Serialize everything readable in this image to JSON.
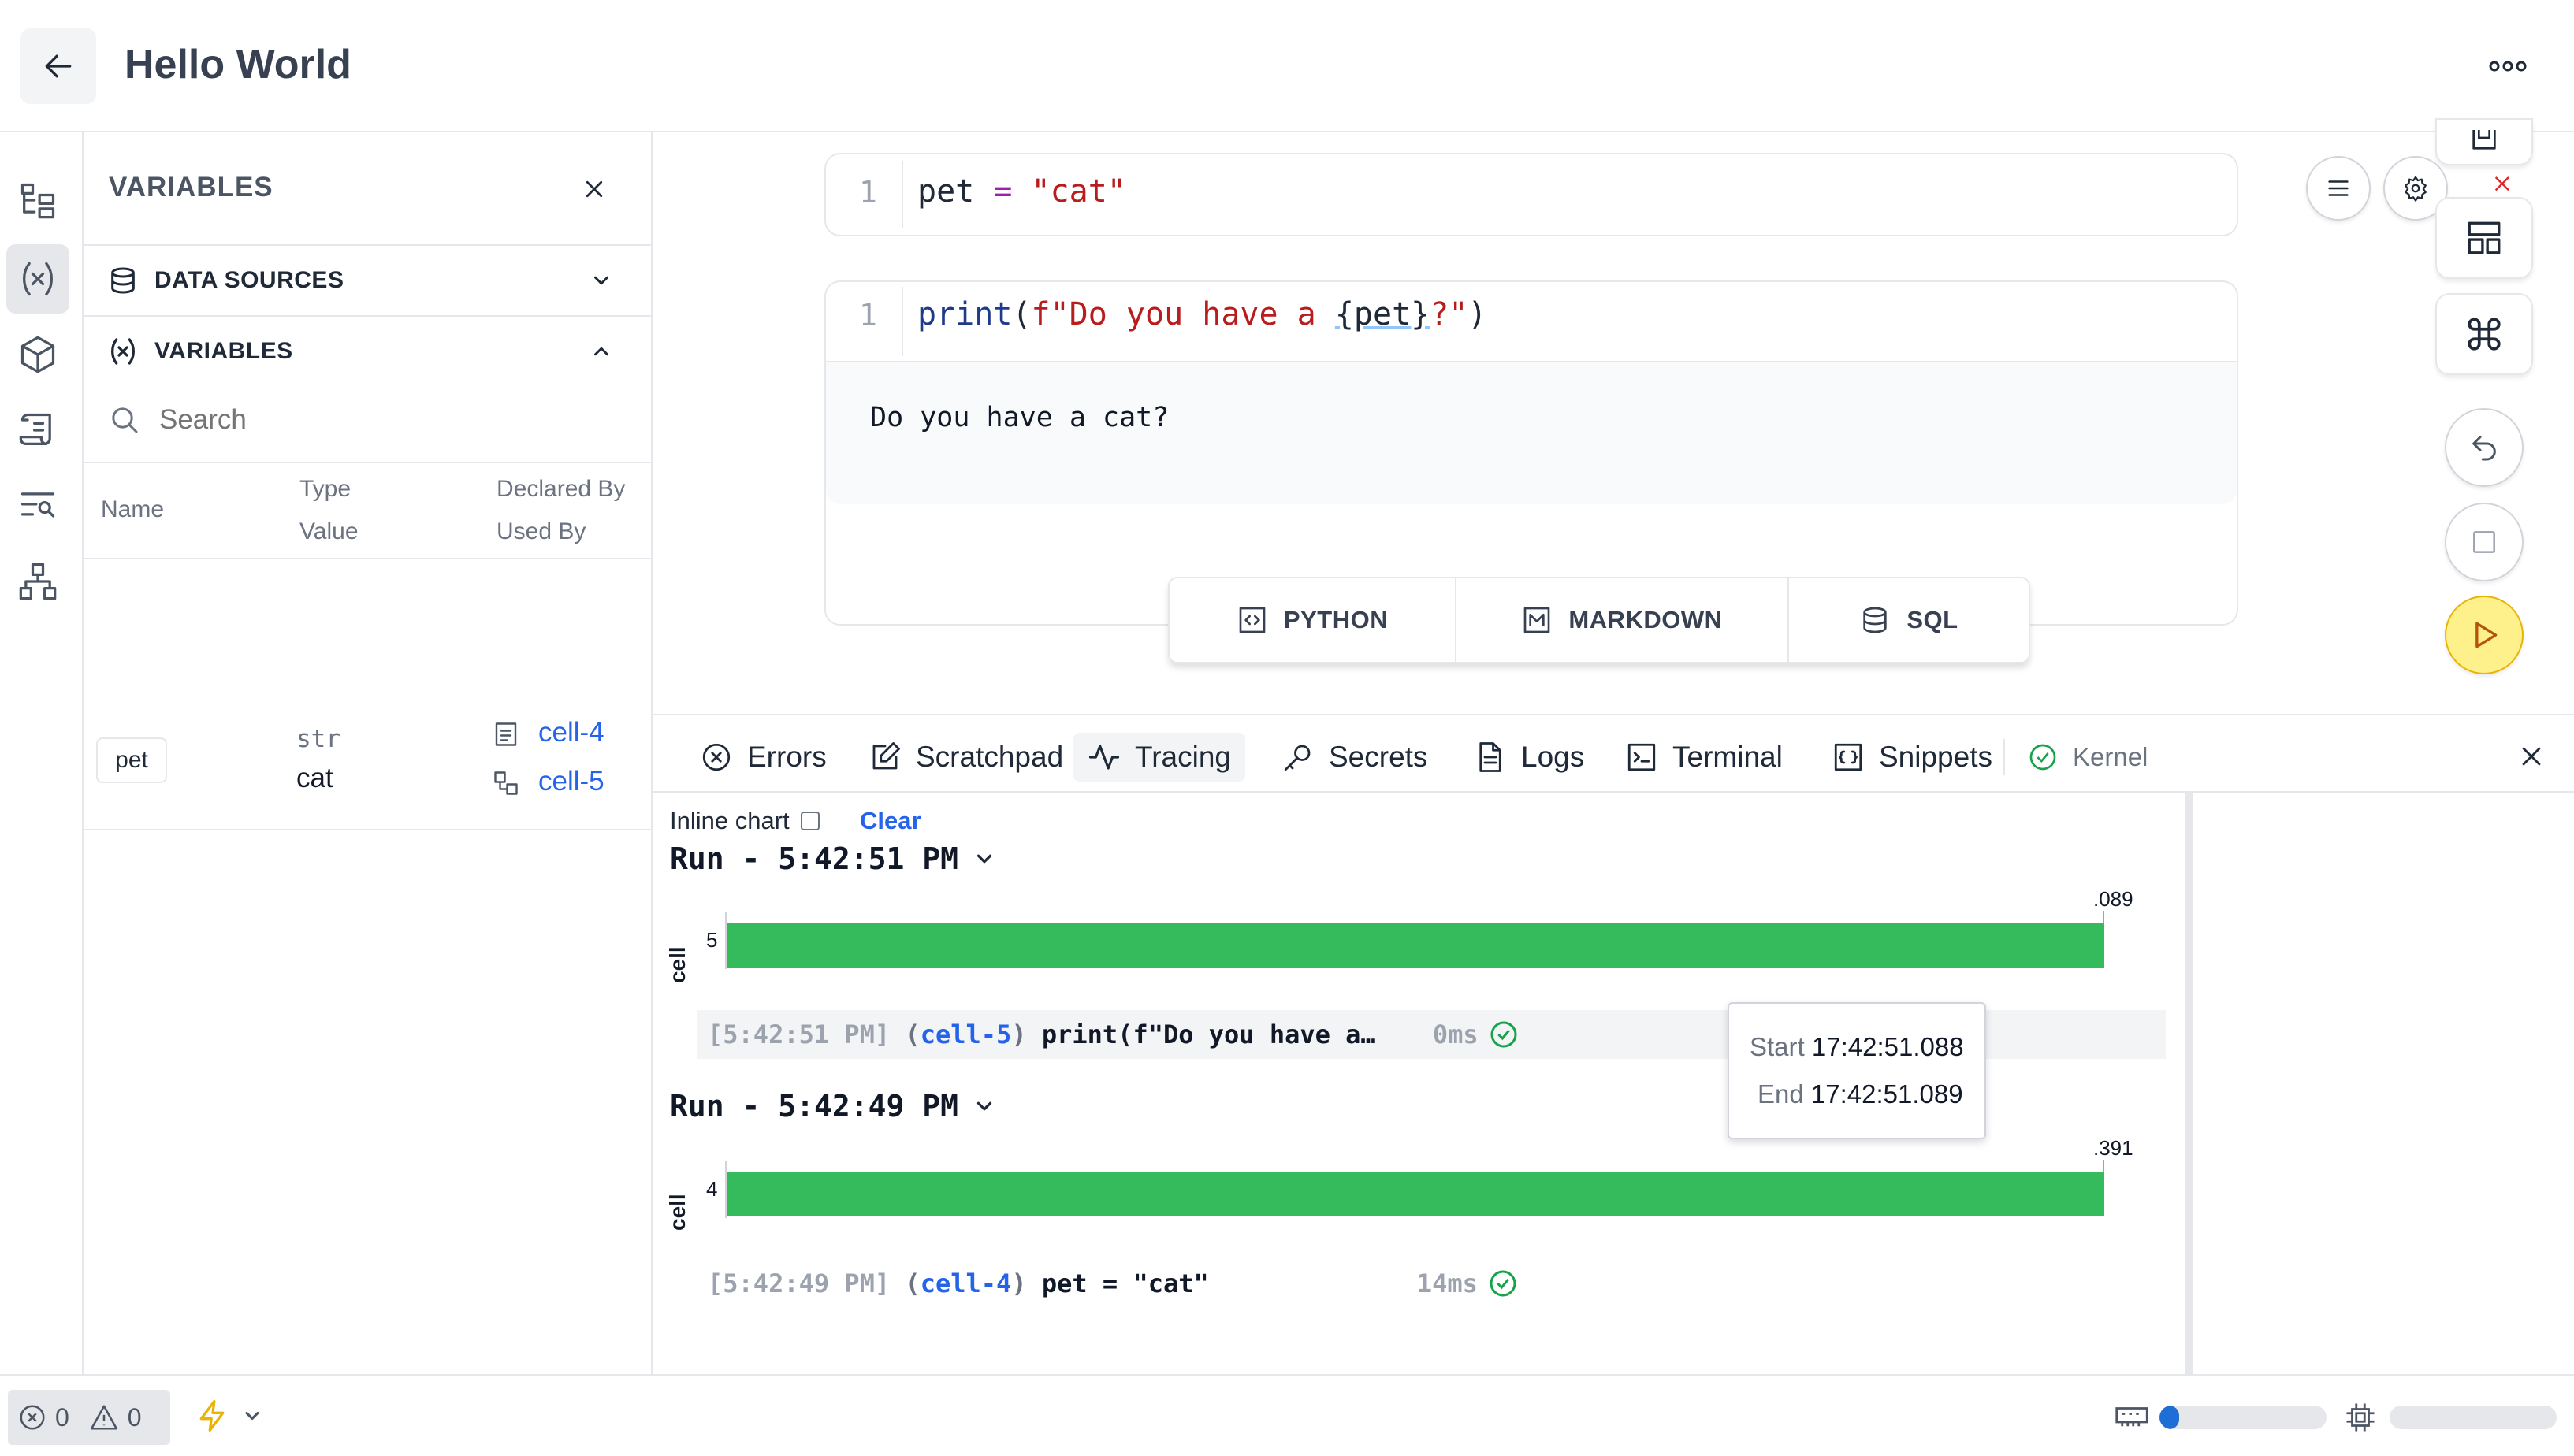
{
  "header": {
    "title": "Hello World"
  },
  "rail": {
    "items": [
      {
        "icon": "file-tree-icon"
      },
      {
        "icon": "variables-icon",
        "active": true
      },
      {
        "icon": "package-icon"
      },
      {
        "icon": "scroll-icon"
      },
      {
        "icon": "search-list-icon"
      },
      {
        "icon": "dependency-graph-icon"
      }
    ]
  },
  "variables_panel": {
    "title": "VARIABLES",
    "sections": {
      "data_sources": "DATA SOURCES",
      "variables": "VARIABLES"
    },
    "search_placeholder": "Search",
    "columns": {
      "name": "Name",
      "type": "Type",
      "value": "Value",
      "declared_by": "Declared By",
      "used_by": "Used By"
    },
    "rows": [
      {
        "name": "pet",
        "type": "str",
        "value": "cat",
        "declared_by": "cell-4",
        "used_by": "cell-5"
      }
    ]
  },
  "cells": [
    {
      "line_number": "1",
      "code": {
        "var": "pet",
        "op": " = ",
        "str": "\"cat\""
      }
    },
    {
      "line_number": "1",
      "code": {
        "fn": "print",
        "open": "(",
        "fstring_a": "f\"Do you have a ",
        "interp": "{pet}",
        "fstring_b": "?\"",
        "close": ")"
      },
      "output": "Do you have a cat?"
    }
  ],
  "add_cell": {
    "python": "PYTHON",
    "markdown": "MARKDOWN",
    "sql": "SQL"
  },
  "bottom_tabs": {
    "errors": "Errors",
    "scratchpad": "Scratchpad",
    "tracing": "Tracing",
    "secrets": "Secrets",
    "logs": "Logs",
    "terminal": "Terminal",
    "snippets": "Snippets",
    "kernel": "Kernel",
    "active": "Tracing"
  },
  "tracing": {
    "inline_chart_label": "Inline chart",
    "inline_chart_checked": false,
    "clear_label": "Clear",
    "axis_label": "cell",
    "runs": [
      {
        "title": "Run - 5:42:51 PM",
        "cell_number": "5",
        "end_label": ".089",
        "log": {
          "time": "[5:42:51 PM]",
          "open": "(",
          "cell": "cell-5",
          "close": ")",
          "code": "print(f\"Do you have a…",
          "duration": "0ms"
        }
      },
      {
        "title": "Run - 5:42:49 PM",
        "cell_number": "4",
        "end_label": ".391",
        "log": {
          "time": "[5:42:49 PM]",
          "open": "(",
          "cell": "cell-4",
          "close": ")",
          "code": "pet = \"cat\"",
          "duration": "14ms"
        }
      }
    ],
    "tooltip": {
      "start_label": "Start",
      "start_value": "17:42:51.088",
      "end_label": "End",
      "end_value": "17:42:51.089"
    }
  },
  "footer": {
    "errors": "0",
    "warnings": "0"
  },
  "colors": {
    "bar_green": "#35bb5b",
    "link_blue": "#2563eb",
    "run_button": "#fef08a",
    "success_green": "#16a34a"
  }
}
